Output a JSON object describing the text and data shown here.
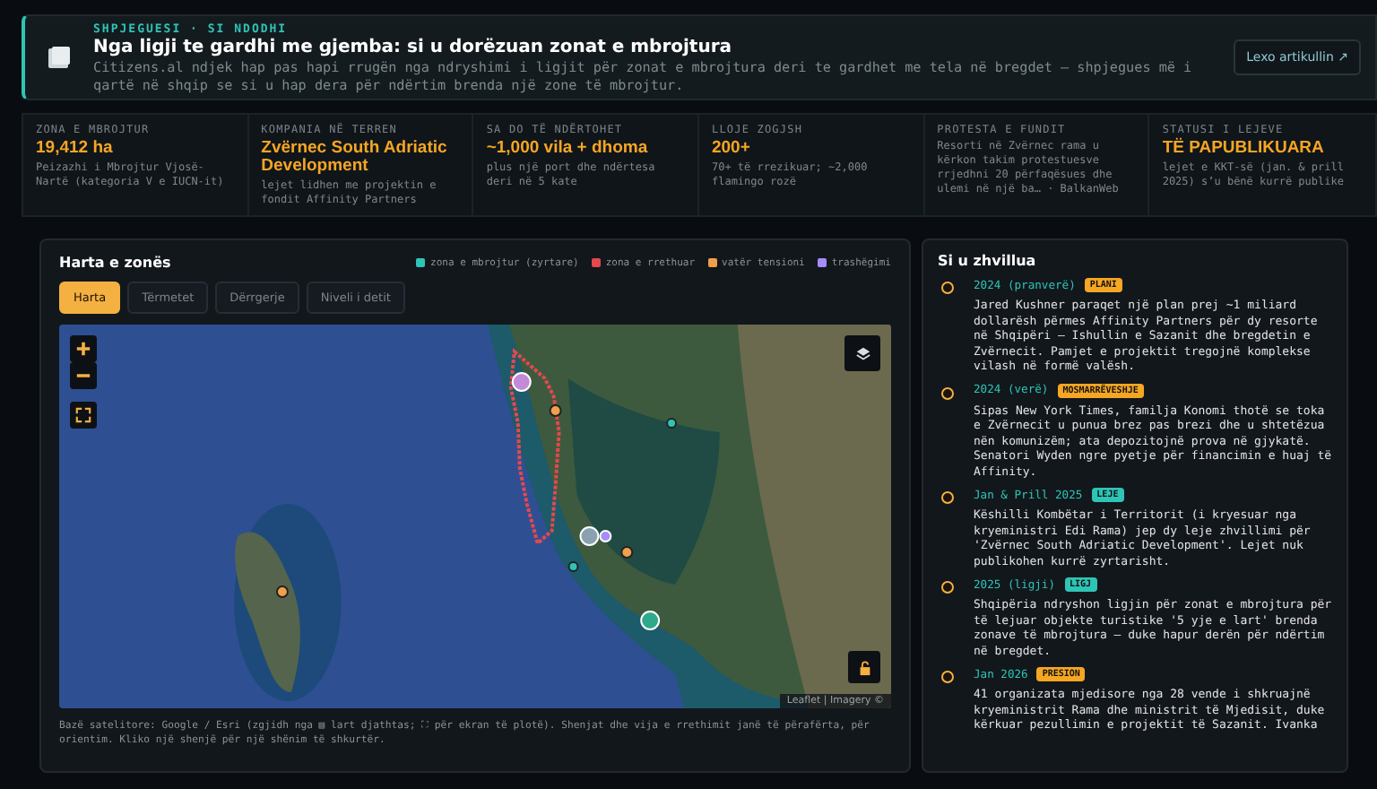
{
  "banner": {
    "kicker": "SHPJEGUESI · SI NDODHI",
    "title": "Nga ligji te gardhi me gjemba: si u dorëzuan zonat e mbrojtura",
    "description": "Citizens.al ndjek hap pas hapi rrugën nga ndryshimi i ligjit për zonat e mbrojtura deri te gardhet me tela në bregdet — shpjegues më i qartë në shqip se si u hap dera për ndërtim brenda një zone të mbrojtur.",
    "button": "Lexo artikullin ↗"
  },
  "stats": [
    {
      "label": "ZONA E MBROJTUR",
      "value": "19,412 ha",
      "note": "Peizazhi i Mbrojtur Vjosë-Nartë (kategoria V e IUCN-it)"
    },
    {
      "label": "KOMPANIA NË TERREN",
      "value": "Zvërnec South Adriatic Development",
      "note": "lejet lidhen me projektin e fondit Affinity Partners"
    },
    {
      "label": "SA DO TË NDËRTOHET",
      "value": "~1,000 vila + dhoma",
      "note": "plus një port dhe ndërtesa deri në 5 kate"
    },
    {
      "label": "LLOJE ZOGJSH",
      "value": "200+",
      "note": "70+ të rrezikuar; ~2,000 flamingo rozë"
    },
    {
      "label": "PROTESTA E FUNDIT",
      "note": "Resorti në Zvërnec rama u kërkon takim protestuesve rrjedhni 20 përfaqësues dhe ulemi në një ba… · BalkanWeb"
    },
    {
      "label": "STATUSI I LEJEVE",
      "value": "TË PAPUBLIKUARA",
      "note": "lejet e KKT-së (jan. & prill 2025) s’u bënë kurrë publike"
    }
  ],
  "map_panel": {
    "title": "Harta e zonës",
    "legend": [
      {
        "label": "zona e mbrojtur (zyrtare)",
        "color": "#2ec4b6"
      },
      {
        "label": "zona e rrethuar",
        "color": "#e5484d"
      },
      {
        "label": "vatër tensioni",
        "color": "#f0a04b"
      },
      {
        "label": "trashëgimi",
        "color": "#a78bfa"
      }
    ],
    "tabs": [
      {
        "label": "Harta",
        "selected": true
      },
      {
        "label": "Tërmetet",
        "selected": false
      },
      {
        "label": "Dërrgerje",
        "selected": false
      },
      {
        "label": "Niveli i detit",
        "selected": false
      }
    ],
    "attribution": "Leaflet | Imagery ©",
    "caption": "Bazë satelitore: Google / Esri (zgjidh nga ▤ lart djathtas; ⛶ për ekran të plotë). Shenjat dhe vija e rrethimit janë të përafërta, për orientim. Kliko një shenjë për një shënim të shkurtër."
  },
  "timeline": {
    "title": "Si u zhvillua",
    "events": [
      {
        "date": "2024 (pranverë)",
        "tag": "PLANI",
        "color": "#f5a623",
        "text": "Jared Kushner paraqet një plan prej ~1 miliard dollarësh përmes Affinity Partners për dy resorte në Shqipëri — Ishullin e Sazanit dhe bregdetin e Zvërnecit. Pamjet e projektit tregojnë komplekse vilash në formë valësh."
      },
      {
        "date": "2024 (verë)",
        "tag": "MOSMARRËVESHJE",
        "color": "#f5a623",
        "text": "Sipas New York Times, familja Konomi thotë se toka e Zvërnecit u punua brez pas brezi dhe u shtetëzua nën komunizëm; ata depozitojnë prova në gjykatë. Senatori Wyden ngre pyetje për financimin e huaj të Affinity."
      },
      {
        "date": "Jan & Prill 2025",
        "tag": "LEJE",
        "color": "#2ec4b6",
        "text": "Këshilli Kombëtar i Territorit (i kryesuar nga kryeministri Edi Rama) jep dy leje zhvillimi për 'Zvërnec South Adriatic Development'. Lejet nuk publikohen kurrë zyrtarisht."
      },
      {
        "date": "2025 (ligji)",
        "tag": "LIGJ",
        "color": "#2ec4b6",
        "text": "Shqipëria ndryshon ligjin për zonat e mbrojtura për të lejuar objekte turistike '5 yje e lart' brenda zonave të mbrojtura — duke hapur derën për ndërtim në bregdet."
      },
      {
        "date": "Jan 2026",
        "tag": "PRESION",
        "color": "#f5a623",
        "text": "41 organizata mjedisore nga 28 vende i shkruajnë kryeministrit Rama dhe ministrit të Mjedisit, duke kërkuar pezullimin e projektit të Sazanit. Ivanka"
      }
    ]
  }
}
